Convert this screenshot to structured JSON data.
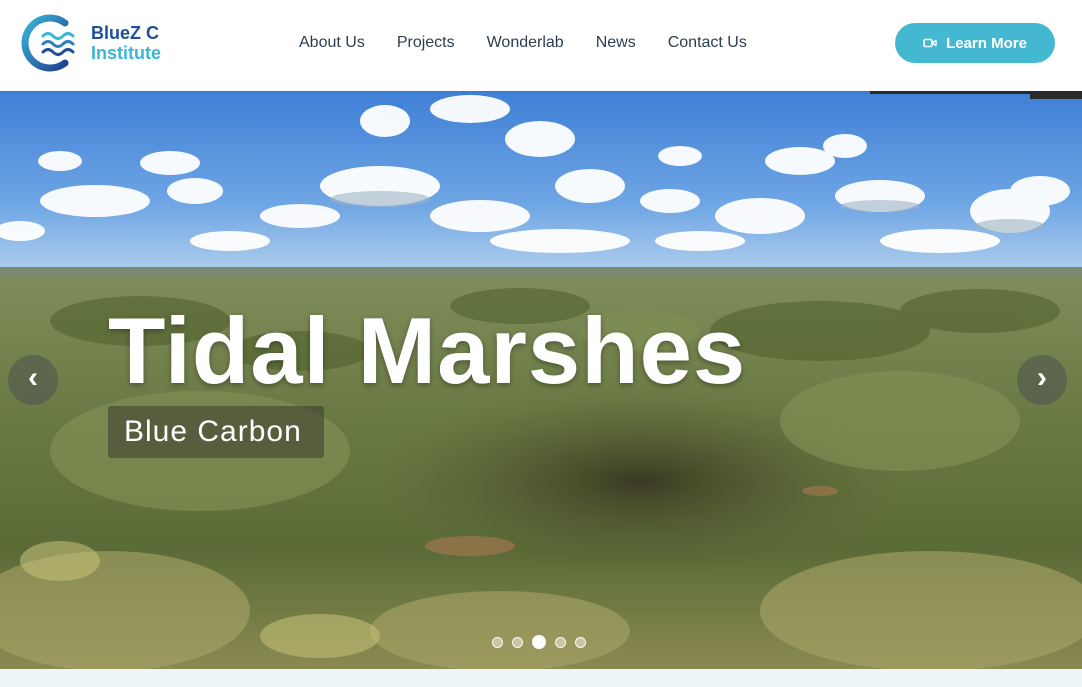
{
  "header": {
    "logo": {
      "line1": "BlueZ C",
      "line2": "Institute"
    },
    "nav": [
      {
        "label": "About Us"
      },
      {
        "label": "Projects"
      },
      {
        "label": "Wonderlab"
      },
      {
        "label": "News"
      },
      {
        "label": "Contact Us"
      }
    ],
    "cta": {
      "label": "Learn More",
      "icon": "video-camera-icon"
    }
  },
  "hero": {
    "title": "Tidal Marshes",
    "subtitle": "Blue Carbon",
    "prev_arrow": "‹",
    "next_arrow": "›",
    "slides_total": 5,
    "active_slide": 3
  },
  "colors": {
    "brand_dark": "#1f4e9b",
    "brand_light": "#3ab7d6",
    "cta_bg": "#45b8d1",
    "nav_text": "#2c3e50"
  }
}
